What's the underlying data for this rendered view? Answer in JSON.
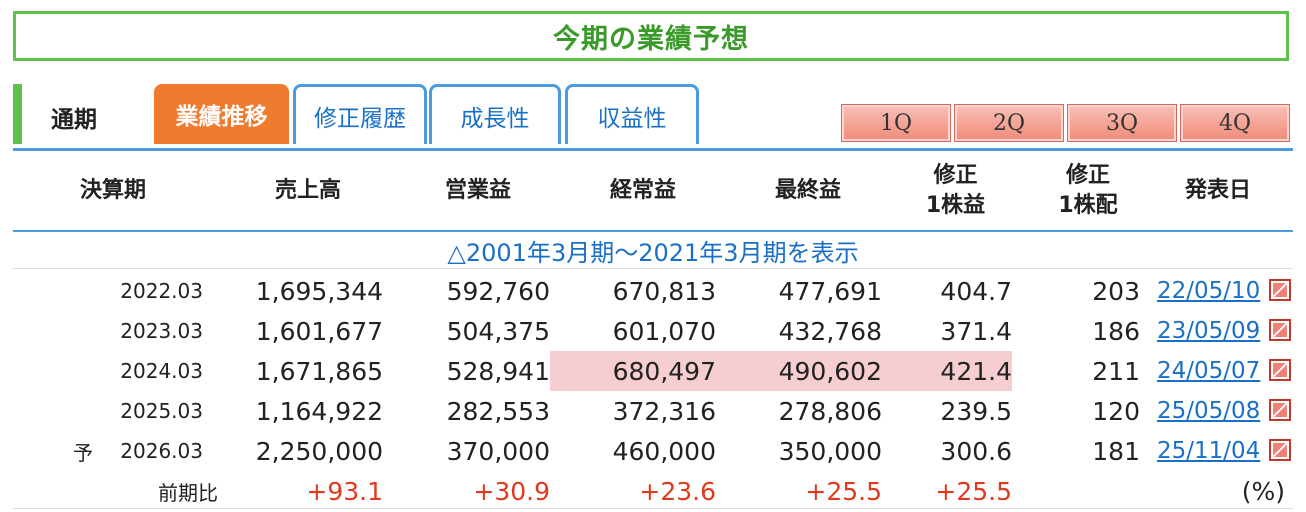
{
  "title": "今期の業績予想",
  "tabs": {
    "static_label": "通期",
    "active": "業績推移",
    "revision": "修正履歴",
    "growth": "成長性",
    "profitability": "収益性"
  },
  "quarter_buttons": [
    "1Q",
    "2Q",
    "3Q",
    "4Q"
  ],
  "columns": {
    "period": "決算期",
    "sales": "売上高",
    "operating": "営業益",
    "ordinary": "経常益",
    "net": "最終益",
    "eps_line1": "修正",
    "eps_line2": "1株益",
    "dps_line1": "修正",
    "dps_line2": "1株配",
    "announce": "発表日"
  },
  "show_range_link": "△2001年3月期〜2021年3月期を表示",
  "rows": [
    {
      "prefix": "",
      "period": "2022.03",
      "sales": "1,695,344",
      "operating": "592,760",
      "ordinary": "670,813",
      "net": "477,691",
      "eps": "404.7",
      "dps": "203",
      "date": "22/05/10"
    },
    {
      "prefix": "",
      "period": "2023.03",
      "sales": "1,601,677",
      "operating": "504,375",
      "ordinary": "601,070",
      "net": "432,768",
      "eps": "371.4",
      "dps": "186",
      "date": "23/05/09"
    },
    {
      "prefix": "",
      "period": "2024.03",
      "sales": "1,671,865",
      "operating": "528,941",
      "ordinary": "680,497",
      "net": "490,602",
      "eps": "421.4",
      "dps": "211",
      "date": "24/05/07"
    },
    {
      "prefix": "",
      "period": "2025.03",
      "sales": "1,164,922",
      "operating": "282,553",
      "ordinary": "372,316",
      "net": "278,806",
      "eps": "239.5",
      "dps": "120",
      "date": "25/05/08"
    },
    {
      "prefix": "予",
      "period": "2026.03",
      "sales": "2,250,000",
      "operating": "370,000",
      "ordinary": "460,000",
      "net": "350,000",
      "eps": "300.6",
      "dps": "181",
      "date": "25/11/04"
    }
  ],
  "yoy": {
    "label": "前期比",
    "sales": "+93.1",
    "operating": "+30.9",
    "ordinary": "+23.6",
    "net": "+25.5",
    "eps": "+25.5",
    "unit": "(%)"
  },
  "colors": {
    "accent_green": "#5cc24a",
    "title_green": "#3a9a2a",
    "tab_orange": "#f07a2e",
    "link_blue": "#1a6fc7",
    "highlight_pink": "#f6cdd0",
    "positive_red": "#e0391e"
  },
  "icons": {
    "announce_doc": "pdf-icon"
  }
}
